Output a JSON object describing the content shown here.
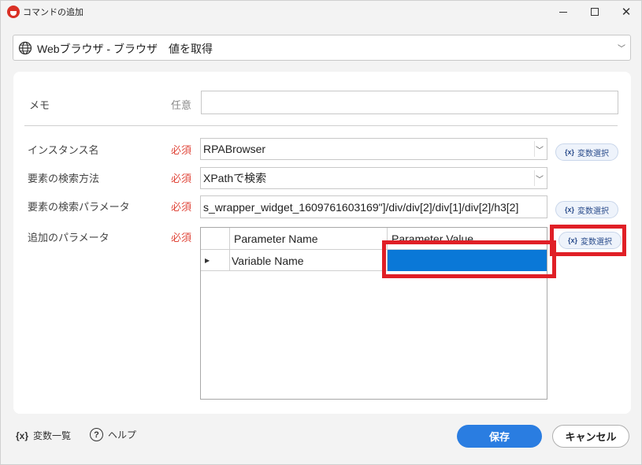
{
  "window": {
    "title": "コマンドの追加"
  },
  "command": {
    "selected": "Webブラウザ - ブラウザ　値を取得"
  },
  "form": {
    "memo_label": "メモ",
    "memo_tag": "任意",
    "memo_value": "",
    "instance_label": "インスタンス名",
    "instance_tag": "必須",
    "instance_value": "RPABrowser",
    "search_method_label": "要素の検索方法",
    "search_method_tag": "必須",
    "search_method_value": "XPathで検索",
    "search_param_label": "要素の検索パラメータ",
    "search_param_tag": "必須",
    "search_param_value": "s_wrapper_widget_1609761603169\"]/div/div[2]/div[1]/div[2]/h3[2]",
    "extra_param_label": "追加のパラメータ",
    "extra_param_tag": "必須",
    "var_select_label": "変数選択",
    "var_select_icon": "{x}"
  },
  "grid": {
    "columns": [
      "Parameter Name",
      "Parameter Value"
    ],
    "rows": [
      {
        "name": "Variable Name",
        "value": ""
      }
    ],
    "row_indicator": "▶"
  },
  "footer": {
    "var_list_icon": "{x}",
    "var_list_label": "変数一覧",
    "help_icon": "?",
    "help_label": "ヘルプ",
    "save_label": "保存",
    "cancel_label": "キャンセル"
  },
  "colors": {
    "primary": "#2a7de1",
    "required": "#e0483c",
    "highlight": "#e01f26",
    "selection": "#0a78d7"
  }
}
